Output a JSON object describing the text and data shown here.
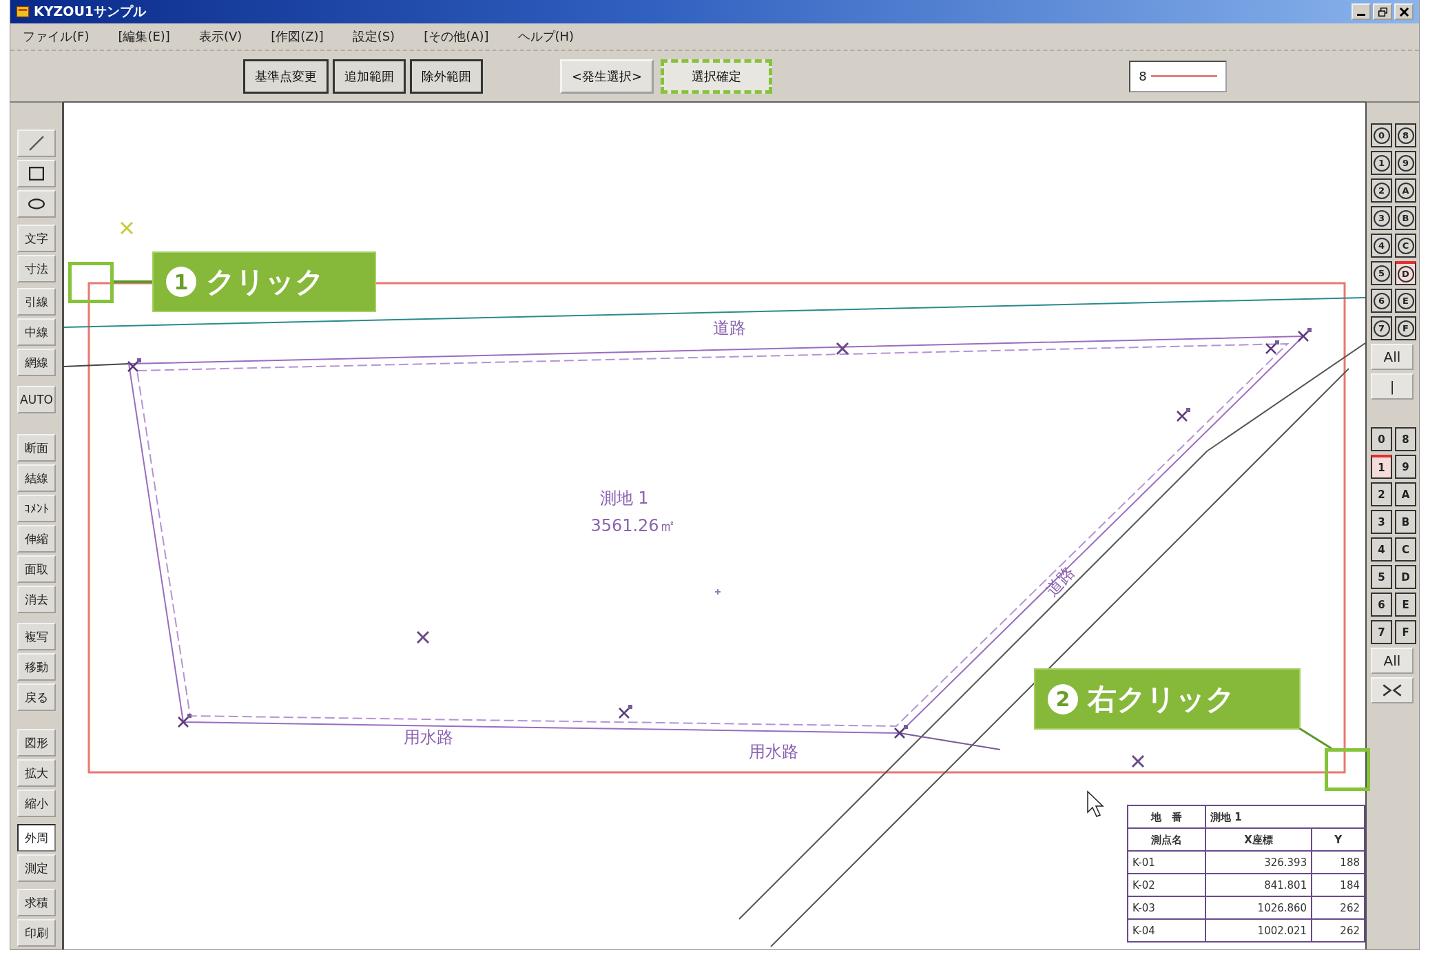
{
  "window": {
    "title": "KYZOU1サンプル"
  },
  "menu": [
    "ファイル(F)",
    "[編集(E)]",
    "表示(V)",
    "[作図(Z)]",
    "設定(S)",
    "[その他(A)]",
    "ヘルプ(H)"
  ],
  "toolbar": {
    "groups": [
      [
        {
          "label": "基準点変更",
          "highlighted": false
        },
        {
          "label": "追加範囲",
          "highlighted": false
        },
        {
          "label": "除外範囲",
          "highlighted": false
        }
      ],
      [
        {
          "label": "<発生選択>",
          "highlighted": false
        },
        {
          "label": "選択確定",
          "highlighted": true
        }
      ]
    ],
    "field": {
      "value": "8"
    }
  },
  "left_toolbar": [
    {
      "items": [
        {
          "kind": "line",
          "selected": false
        },
        {
          "kind": "rectangle",
          "selected": false
        },
        {
          "kind": "ellipse",
          "selected": false
        }
      ]
    },
    {
      "items": [
        {
          "kind": "label",
          "label": "文字",
          "selected": false
        },
        {
          "kind": "label",
          "label": "寸法",
          "selected": false
        }
      ]
    },
    {
      "items": [
        {
          "kind": "label",
          "label": "引線",
          "selected": false
        },
        {
          "kind": "label",
          "label": "中線",
          "selected": false
        },
        {
          "kind": "label",
          "label": "網線",
          "selected": false
        }
      ]
    },
    {
      "items": [
        {
          "kind": "label",
          "label": "AUTO",
          "selected": false
        }
      ]
    },
    {
      "items": [
        {
          "kind": "label",
          "label": "断面",
          "selected": false
        },
        {
          "kind": "label",
          "label": "結線",
          "selected": false
        },
        {
          "kind": "label",
          "label": "ｺﾒﾝﾄ",
          "selected": false
        },
        {
          "kind": "label",
          "label": "伸縮",
          "selected": false
        },
        {
          "kind": "label",
          "label": "面取",
          "selected": false
        },
        {
          "kind": "label",
          "label": "消去",
          "selected": false
        }
      ]
    },
    {
      "items": [
        {
          "kind": "label",
          "label": "複写",
          "selected": false
        },
        {
          "kind": "label",
          "label": "移動",
          "selected": false
        },
        {
          "kind": "label",
          "label": "戻る",
          "selected": false
        }
      ]
    },
    {
      "items": [
        {
          "kind": "label",
          "label": "図形",
          "selected": false
        },
        {
          "kind": "label",
          "label": "拡大",
          "selected": false
        },
        {
          "kind": "label",
          "label": "縮小",
          "selected": false
        }
      ]
    },
    {
      "items": [
        {
          "kind": "label",
          "label": "外周",
          "selected": true
        },
        {
          "kind": "label",
          "label": "測定",
          "selected": false
        }
      ]
    },
    {
      "items": [
        {
          "kind": "label",
          "label": "求積",
          "selected": false
        },
        {
          "kind": "label",
          "label": "印刷",
          "selected": false
        }
      ]
    }
  ],
  "layer_panel": [
    {
      "kind": "circle",
      "rows": [
        [
          {
            "label": "0",
            "selected": false
          },
          {
            "label": "8",
            "selected": false
          }
        ],
        [
          {
            "label": "1",
            "selected": false
          },
          {
            "label": "9",
            "selected": false
          }
        ],
        [
          {
            "label": "2",
            "selected": false
          },
          {
            "label": "A",
            "selected": false
          }
        ],
        [
          {
            "label": "3",
            "selected": false
          },
          {
            "label": "B",
            "selected": false
          }
        ],
        [
          {
            "label": "4",
            "selected": false
          },
          {
            "label": "C",
            "selected": false
          }
        ],
        [
          {
            "label": "5",
            "selected": false
          },
          {
            "label": "D",
            "selected": true
          }
        ],
        [
          {
            "label": "6",
            "selected": false
          },
          {
            "label": "E",
            "selected": false
          }
        ],
        [
          {
            "label": "7",
            "selected": false
          },
          {
            "label": "F",
            "selected": false
          }
        ]
      ],
      "all_label": "All",
      "extra": {
        "kind": "text",
        "label": "|"
      }
    },
    {
      "kind": "square",
      "rows": [
        [
          {
            "label": "0",
            "selected": false
          },
          {
            "label": "8",
            "selected": false
          }
        ],
        [
          {
            "label": "1",
            "selected": true
          },
          {
            "label": "9",
            "selected": false
          }
        ],
        [
          {
            "label": "2",
            "selected": false
          },
          {
            "label": "A",
            "selected": false
          }
        ],
        [
          {
            "label": "3",
            "selected": false
          },
          {
            "label": "B",
            "selected": false
          }
        ],
        [
          {
            "label": "4",
            "selected": false
          },
          {
            "label": "C",
            "selected": false
          }
        ],
        [
          {
            "label": "5",
            "selected": false
          },
          {
            "label": "D",
            "selected": false
          }
        ],
        [
          {
            "label": "6",
            "selected": false
          },
          {
            "label": "E",
            "selected": false
          }
        ],
        [
          {
            "label": "7",
            "selected": false
          },
          {
            "label": "F",
            "selected": false
          }
        ]
      ],
      "all_label": "All",
      "extra": {
        "kind": "icon"
      }
    }
  ],
  "drawing": {
    "labels": [
      "道路",
      "測地 1",
      "3561.26㎡",
      "用水路",
      "用水路",
      "道路"
    ]
  },
  "coordinate_table": {
    "title_label": "地　番",
    "title_value": "測地 1",
    "columns": [
      "測点名",
      "X座標",
      "Y"
    ],
    "rows": [
      [
        "K-01",
        "326.393",
        "188"
      ],
      [
        "K-02",
        "841.801",
        "184"
      ],
      [
        "K-03",
        "1026.860",
        "262"
      ],
      [
        "K-04",
        "1002.021",
        "262"
      ]
    ]
  },
  "callouts": [
    {
      "number": "1",
      "text": "クリック"
    },
    {
      "number": "2",
      "text": "右クリック"
    }
  ]
}
